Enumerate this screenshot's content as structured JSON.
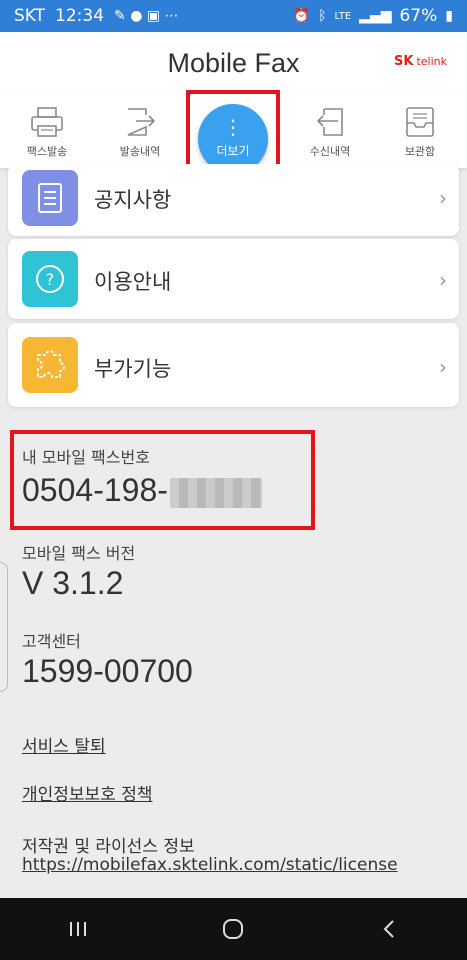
{
  "status_bar": {
    "carrier": "SKT",
    "time": "12:34",
    "signal_label": "LTE",
    "battery": "67%"
  },
  "header": {
    "title": "Mobile Fax",
    "brand_mark": "SK",
    "brand_name": "telink"
  },
  "tabs": [
    {
      "label": "팩스발송",
      "icon": "printer-icon"
    },
    {
      "label": "발송내역",
      "icon": "sent-history-icon"
    },
    {
      "label": "더보기",
      "icon": "more-icon"
    },
    {
      "label": "수신내역",
      "icon": "received-history-icon"
    },
    {
      "label": "보관함",
      "icon": "archive-icon"
    }
  ],
  "menu": [
    {
      "label": "공지사항",
      "icon": "notice-icon",
      "color": "#7f8fe6"
    },
    {
      "label": "이용안내",
      "icon": "help-icon",
      "color": "#2ec4d6"
    },
    {
      "label": "부가기능",
      "icon": "puzzle-icon",
      "color": "#f7b733"
    }
  ],
  "info": {
    "fax_number_label": "내 모바일 팩스번호",
    "fax_number_visible": "0504-198-",
    "version_label": "모바일 팩스 버전",
    "version_value": "V 3.1.2",
    "support_label": "고객센터",
    "support_value": "1599-00700"
  },
  "links": {
    "withdraw": "서비스 탈퇴",
    "privacy": "개인정보보호 정책",
    "copyright_label": "저작권 및 라이선스 정보",
    "license_url": "https://mobilefax.sktelink.com/static/license"
  },
  "colors": {
    "status_bar": "#2f7fd6",
    "accent": "#3aa0f0",
    "highlight": "#e3141b"
  }
}
